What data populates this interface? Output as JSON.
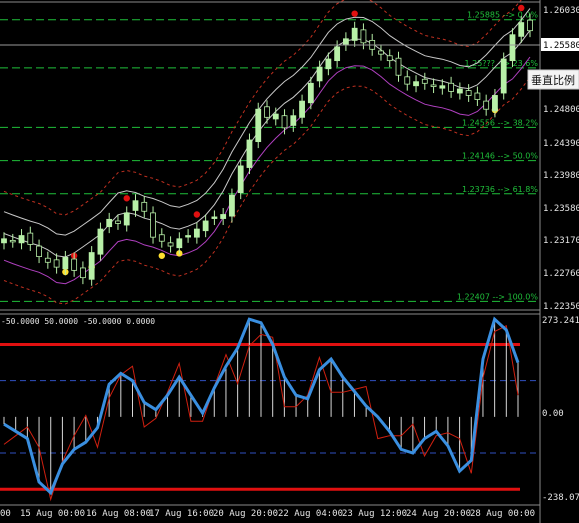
{
  "price_panel": {
    "y_ticks": [
      "1.26030",
      "1.25580",
      "1.24800",
      "1.24390",
      "1.23980",
      "1.23580",
      "1.23170",
      "1.22760",
      "1.22350"
    ],
    "current_price": "1.25580",
    "scale_button": "垂直比例",
    "fib_labels": [
      "1.25885 --> 0.0%",
      "1.25??? --> 23.6%",
      "1.24556 --> 38.2%",
      "1.24146 --> 50.0%",
      "1.23736 --> 61.8%",
      "1.22407 --> 100.0%"
    ]
  },
  "indicator_panel": {
    "header": "-50.0000 50.0000 -50.0000 0.0000",
    "y_ticks": [
      "273.2415",
      "0.00",
      "-238.0762"
    ]
  },
  "time_axis": {
    "labels": [
      "00",
      "15 Aug 00:00",
      "16 Aug 08:00",
      "17 Aug 16:00",
      "20 Aug 20:00",
      "22 Aug 04:00",
      "23 Aug 12:00",
      "24 Aug 20:00",
      "28 Aug 00:00"
    ]
  },
  "colors": {
    "background": "#000000",
    "bull_candle": "#b8f0a8",
    "bear_candle": "#000000",
    "fib_line": "#1fbf3a",
    "upper_band": "#c8c8c8",
    "lower_band": "#b040c0",
    "env_line": "#c03020",
    "marker_up": "#ffe030",
    "marker_down": "#e01010",
    "cci_line": "#3a8fe0",
    "cci_thin": "#d02010",
    "level_line": "#e01010",
    "dash_line": "#3050c0"
  },
  "chart_data": {
    "type": "candlestick",
    "price_series": {
      "close": [
        1.2318,
        1.2315,
        1.2322,
        1.2311,
        1.2296,
        1.2289,
        1.2283,
        1.2295,
        1.2279,
        1.227,
        1.2301,
        1.233,
        1.2342,
        1.2337,
        1.235,
        1.2365,
        1.2352,
        1.232,
        1.2315,
        1.2309,
        1.2318,
        1.2322,
        1.233,
        1.234,
        1.2345,
        1.2348,
        1.2372,
        1.2408,
        1.244,
        1.2478,
        1.2468,
        1.2472,
        1.2455,
        1.247,
        1.2488,
        1.251,
        1.253,
        1.254,
        1.2555,
        1.2565,
        1.2578,
        1.256,
        1.2552,
        1.2546,
        1.2538,
        1.252,
        1.2509,
        1.2512,
        1.251,
        1.2506,
        1.2507,
        1.25,
        1.2503,
        1.2495,
        1.249,
        1.2478,
        1.2495,
        1.254,
        1.257,
        1.2585,
        1.2575
      ]
    },
    "indicator_levels": [
      100,
      0,
      -100
    ],
    "cci_series": [
      -20,
      -40,
      -60,
      -180,
      -210,
      -130,
      -90,
      -70,
      -30,
      90,
      120,
      100,
      40,
      20,
      60,
      110,
      60,
      10,
      80,
      140,
      190,
      270,
      260,
      200,
      110,
      60,
      50,
      130,
      160,
      110,
      70,
      30,
      0,
      -40,
      -90,
      -100,
      -60,
      -40,
      -80,
      -150,
      -120,
      160,
      270,
      240,
      150
    ]
  }
}
